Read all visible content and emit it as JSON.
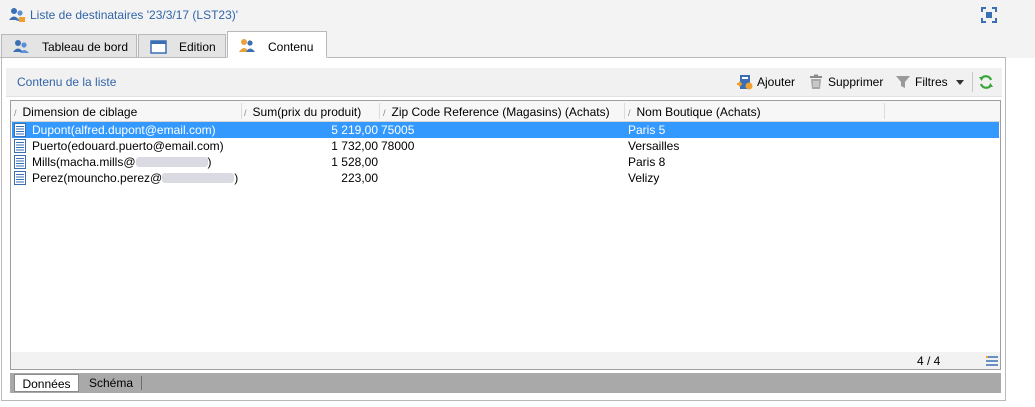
{
  "window": {
    "title": "Liste de destinataires '23/3/17 (LST23)'",
    "icon": "recipients-icon",
    "maximize_icon": "maximize-icon"
  },
  "tabs": [
    {
      "label": "Tableau de bord",
      "icon": "dashboard-people-icon",
      "active": false
    },
    {
      "label": "Edition",
      "icon": "window-edit-icon",
      "active": false
    },
    {
      "label": "Contenu",
      "icon": "people-icon",
      "active": true
    }
  ],
  "toolbar": {
    "title": "Contenu de la liste",
    "add_label": "Ajouter",
    "delete_label": "Supprimer",
    "filters_label": "Filtres",
    "refresh_icon": "refresh-icon"
  },
  "grid": {
    "columns": [
      "Dimension de ciblage",
      "Sum(prix du produit)",
      "Zip Code Reference (Magasins) (Achats)",
      "Nom Boutique (Achats)"
    ],
    "rows": [
      {
        "name": "Dupont(alfred.dupont@email.com)",
        "name_suffix": "",
        "sum": "5 219,00",
        "zip": "75005",
        "shop": "Paris 5",
        "selected": true,
        "redacted": false
      },
      {
        "name": "Puerto(edouard.puerto@email.com)",
        "name_suffix": "",
        "sum": "1 732,00",
        "zip": "78000",
        "shop": "Versailles",
        "selected": false,
        "redacted": false
      },
      {
        "name": "Mills(macha.mills@",
        "name_suffix": ")",
        "sum": "1 528,00",
        "zip": "",
        "shop": "Paris 8",
        "selected": false,
        "redacted": true
      },
      {
        "name": "Perez(mouncho.perez@",
        "name_suffix": ")",
        "sum": "223,00",
        "zip": "",
        "shop": "Velizy",
        "selected": false,
        "redacted": true
      }
    ],
    "counter": "4 / 4"
  },
  "bottom_tabs": [
    {
      "label": "Données",
      "active": true
    },
    {
      "label": "Schéma",
      "active": false
    }
  ],
  "colors": {
    "accent": "#3265a8",
    "selection": "#3399ff"
  }
}
